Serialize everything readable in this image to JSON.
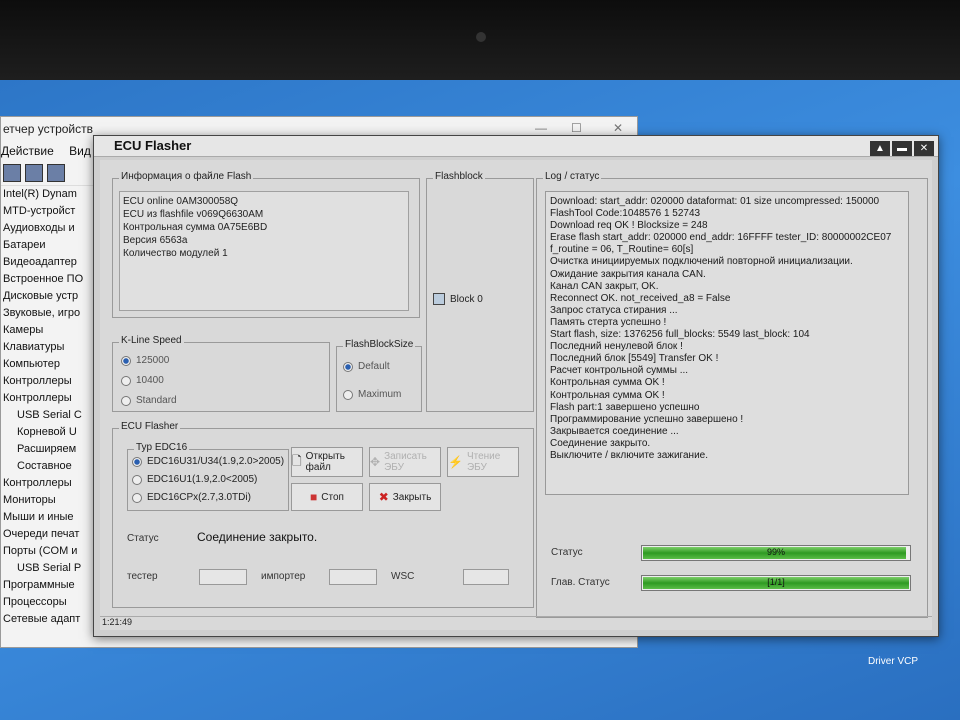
{
  "devmgr": {
    "title": "етчер устройств",
    "menu": [
      "Действие",
      "Вид"
    ],
    "items": [
      {
        "label": "Intel(R) Dynam",
        "sub": false
      },
      {
        "label": "MTD-устройст",
        "sub": false
      },
      {
        "label": "Аудиовходы и",
        "sub": false
      },
      {
        "label": "Батареи",
        "sub": false
      },
      {
        "label": "Видеоадаптер",
        "sub": false
      },
      {
        "label": "Встроенное ПО",
        "sub": false
      },
      {
        "label": "Дисковые устр",
        "sub": false
      },
      {
        "label": "Звуковые, игро",
        "sub": false
      },
      {
        "label": "Камеры",
        "sub": false
      },
      {
        "label": "Клавиатуры",
        "sub": false
      },
      {
        "label": "Компьютер",
        "sub": false
      },
      {
        "label": "Контроллеры",
        "sub": false
      },
      {
        "label": "Контроллеры",
        "sub": false
      },
      {
        "label": "USB Serial C",
        "sub": true
      },
      {
        "label": "Корневой U",
        "sub": true
      },
      {
        "label": "Расширяем",
        "sub": true
      },
      {
        "label": "Составное",
        "sub": true
      },
      {
        "label": "Контроллеры",
        "sub": false
      },
      {
        "label": "Мониторы",
        "sub": false
      },
      {
        "label": "Мыши и иные",
        "sub": false
      },
      {
        "label": "Очереди печат",
        "sub": false
      },
      {
        "label": "Порты (COM и",
        "sub": false
      },
      {
        "label": "USB Serial P",
        "sub": true
      },
      {
        "label": "Программные",
        "sub": false
      },
      {
        "label": "Процессоры",
        "sub": false
      },
      {
        "label": "Сетевые адапт",
        "sub": false
      }
    ]
  },
  "app": {
    "title": "ECU Flasher",
    "info": {
      "legend": "Информация  о файле Flash",
      "lines": [
        "ECU online 0AM300058Q",
        "ECU из flashfile v069Q6630AM",
        "Контрольная сумма 0A75E6BD",
        "Версия 6563а",
        "Количество модулей 1"
      ]
    },
    "flashblock": {
      "legend": "Flashblock",
      "checkbox_label": "Block 0"
    },
    "kline": {
      "legend": "K-Line Speed",
      "options": [
        "125000",
        "10400",
        "Standard"
      ],
      "selected": "125000"
    },
    "blocksize": {
      "legend": "FlashBlockSize",
      "options": [
        "Default",
        "Maximum"
      ],
      "selected": "Default"
    },
    "flasher": {
      "legend": "ECU Flasher",
      "type_legend": "Typ EDC16",
      "types": [
        "EDC16U31/U34(1.9,2.0>2005)",
        "EDC16U1(1.9,2.0<2005)",
        "EDC16CPx(2.7,3.0TDi)"
      ],
      "open_label": "Открыть файл",
      "write_label": "Записать ЭБУ",
      "read_label": "Чтение ЭБУ",
      "stop_label": "Стоп",
      "close_label": "Закрыть",
      "status_label": "Статус",
      "status_value": "Соединение закрыто.",
      "tester_label": "тестер",
      "importer_label": "импортер",
      "wsc_label": "WSC"
    },
    "log": {
      "legend": "Log / статус",
      "lines": [
        "Download: start_addr: 020000 dataformat: 01 size uncompressed: 150000",
        "FlashTool Code:1048576 1 52743",
        "Download req OK ! Blocksize = 248",
        "Erase flash start_addr: 020000 end_addr: 16FFFF tester_ID: 80000002CE07",
        "f_routine = 06, T_Routine= 60[s]",
        "Очистка инициируемых подключений повторной инициализации.",
        "Ожидание закрытия канала CAN.",
        "Канал CAN закрыт, OK.",
        "Reconnect OK. not_received_a8 = False",
        "Запрос статуса стирания ...",
        "Память стерта успешно !",
        "Start flash, size: 1376256 full_blocks: 5549 last_block: 104",
        "Последний ненулевой блок !",
        "Последний блок [5549] Transfer OK !",
        "Расчет контрольной суммы ...",
        "Контрольная сумма OK !",
        "Контрольная сумма OK !",
        "Flash part:1 завершено успешно",
        "Программирование успешно завершено !",
        "Закрывается соединение ...",
        "Соединение закрыто.",
        "Выключите / включите зажигание."
      ]
    },
    "progress": {
      "status_label": "Статус",
      "status_value": 0.99,
      "status_text": "99%",
      "main_label": "Глав. Статус",
      "main_value": 1.0,
      "main_text": "[1/1]"
    },
    "statusbar": {
      "time": "1:21:49"
    }
  },
  "taskbar_icon_label": "Driver VCP"
}
